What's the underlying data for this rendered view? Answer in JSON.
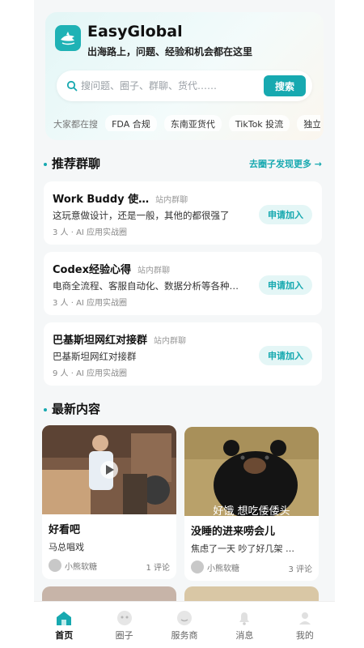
{
  "app": {
    "title": "EasyGlobal",
    "subtitle": "出海路上，问题、经验和机会都在这里"
  },
  "search": {
    "placeholder": "搜问题、圈子、群聊、货代……",
    "button": "搜索"
  },
  "hot": {
    "label": "大家都在搜",
    "tags": [
      "FDA 合规",
      "东南亚货代",
      "TikTok 投流",
      "独立"
    ]
  },
  "groups_section": {
    "title": "推荐群聊",
    "more": "去圈子发现更多 →",
    "items": [
      {
        "name": "Work Buddy 使…",
        "kind": "站内群聊",
        "desc": "这玩意做设计，还是一般，其他的都很强了",
        "meta": "3 人 · AI 应用实战圈",
        "action": "申请加入"
      },
      {
        "name": "Codex经验心得",
        "kind": "站内群聊",
        "desc": "电商全流程、客服自动化、数据分析等各种…",
        "meta": "3 人 · AI 应用实战圈",
        "action": "申请加入"
      },
      {
        "name": "巴基斯坦网红对接群",
        "kind": "站内群聊",
        "desc": "巴基斯坦网红对接群",
        "meta": "9 人 · AI 应用实战圈",
        "action": "申请加入"
      }
    ]
  },
  "feed_section": {
    "title": "最新内容",
    "items": [
      {
        "title": "好看吧",
        "desc": "马总唱戏",
        "author": "小熊软糖",
        "comments": "1 评论"
      },
      {
        "title": "没睡的进来唠会儿",
        "desc": "焦虑了一天 吵了好几架 …",
        "author": "小熊软糖",
        "comments": "3 评论",
        "overlay": "好饿 想吃倭倭头"
      }
    ]
  },
  "tabs": [
    {
      "label": "首页",
      "icon": "home-icon",
      "active": true
    },
    {
      "label": "圈子",
      "icon": "circle-icon",
      "active": false
    },
    {
      "label": "服务商",
      "icon": "service-icon",
      "active": false
    },
    {
      "label": "消息",
      "icon": "bell-icon",
      "active": false
    },
    {
      "label": "我的",
      "icon": "user-icon",
      "active": false
    }
  ],
  "colors": {
    "accent": "#17a9b0",
    "accent_light": "#e4f6f6"
  }
}
